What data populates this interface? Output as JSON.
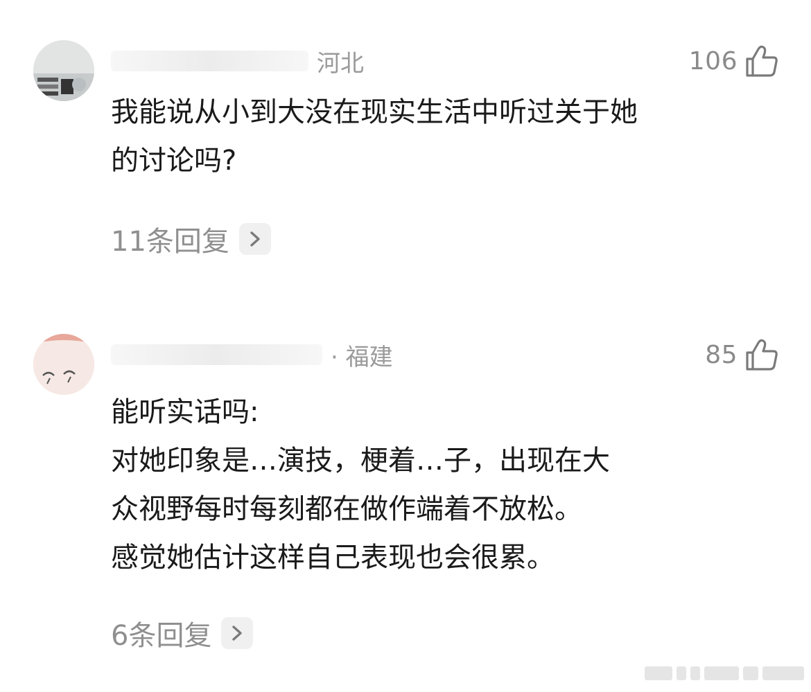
{
  "comments": [
    {
      "location": "河北",
      "likes": "106",
      "text_lines": [
        "我能说从小到大没在现实生活中听过关于她",
        "的讨论吗?"
      ],
      "replies_label": "11条回复",
      "icons": {
        "like": "thumbs-up-icon",
        "replies": "chevron-right-icon"
      }
    },
    {
      "location": "· 福建",
      "likes": "85",
      "text_lines": [
        "能听实话吗:",
        "对她印象是…演技，梗着…子，出现在大",
        "众视野每时每刻都在做作端着不放松。",
        "感觉她估计这样自己表现也会很累。"
      ],
      "replies_label": "6条回复",
      "icons": {
        "like": "thumbs-up-icon",
        "replies": "chevron-right-icon"
      }
    }
  ],
  "colors": {
    "text": "#1a1a1a",
    "muted": "#8f8f8f",
    "chevron_bg": "#f0f0f0"
  }
}
